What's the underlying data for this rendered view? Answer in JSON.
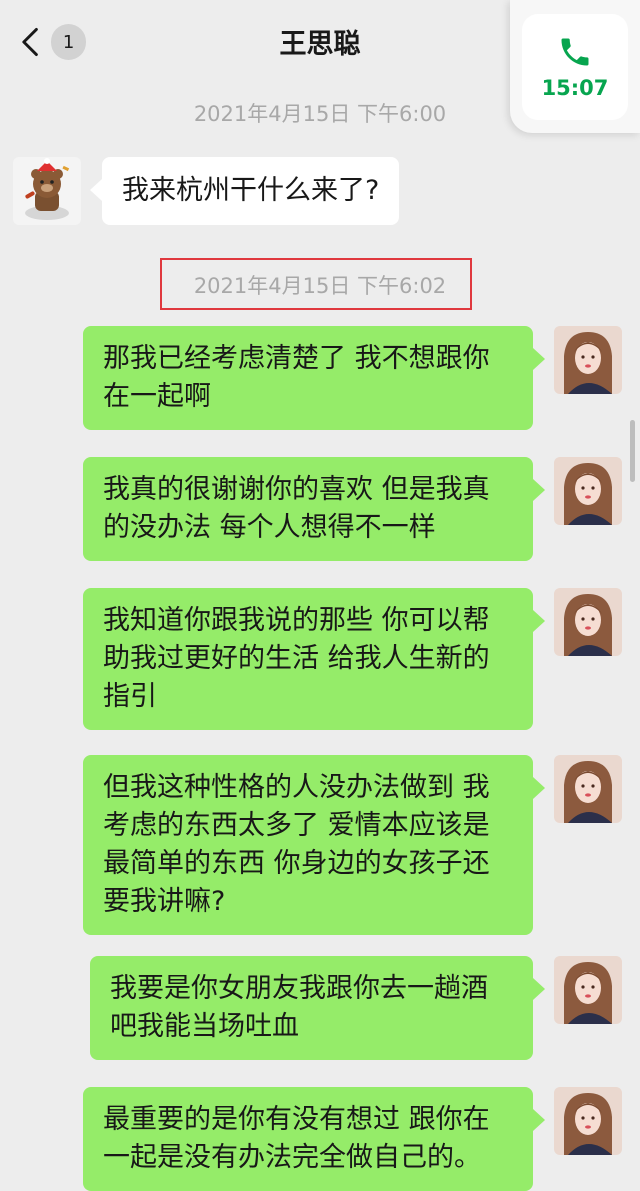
{
  "nav": {
    "back_count": "1",
    "title": "王思聪"
  },
  "call_float": {
    "time": "15:07",
    "icon": "phone-icon",
    "color": "#07a54f"
  },
  "timestamps": [
    "2021年4月15日 下午6:00",
    "2021年4月15日 下午6:02"
  ],
  "messages": [
    {
      "side": "in",
      "text": "我来杭州干什么来了?"
    },
    {
      "side": "out",
      "lines": [
        "那我已经考虑清楚了 我不想跟你",
        "在一起啊"
      ]
    },
    {
      "side": "out",
      "lines": [
        "我真的很谢谢你的喜欢 但是我真",
        "的没办法 每个人想得不一样"
      ]
    },
    {
      "side": "out",
      "lines": [
        "我知道你跟我说的那些 你可以帮",
        "助我过更好的生活 给我人生新的",
        "指引"
      ]
    },
    {
      "side": "out",
      "lines": [
        "但我这种性格的人没办法做到 我",
        "考虑的东西太多了 爱情本应该是",
        "最简单的东西 你身边的女孩子还",
        "要我讲嘛?"
      ]
    },
    {
      "side": "out",
      "lines": [
        "我要是你女朋友我跟你去一趟酒",
        "吧我能当场吐血"
      ]
    },
    {
      "side": "out",
      "lines": [
        "最重要的是你有没有想过 跟你在",
        "一起是没有办法完全做自己的。"
      ]
    }
  ],
  "colors": {
    "bubble_out": "#95ec69",
    "bubble_in": "#ffffff",
    "background": "#ededed",
    "highlight_box": "#e0383e"
  }
}
